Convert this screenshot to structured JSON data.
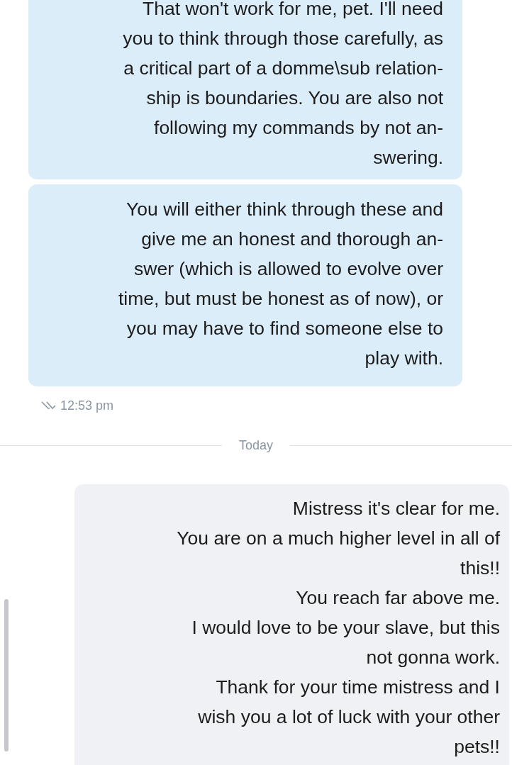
{
  "thread": [
    {
      "kind": "incoming",
      "text": "That won't work for me, pet. I'll need\nyou to think through those carefully, as\na critical part of a domme\\sub relation-\nship is boundaries. You are also not\nfollowing my commands by not an-\nswering."
    },
    {
      "kind": "incoming",
      "text": "You will either think through these and\ngive me an honest and thorough an-\nswer (which is allowed to evolve over\ntime, but must be honest as of now), or\nyou may have to find someone else to\nplay with."
    },
    {
      "kind": "meta",
      "time": "12:53 pm",
      "read": true
    },
    {
      "kind": "divider",
      "label": "Today"
    },
    {
      "kind": "outgoing",
      "text": "Mistress it's clear for me.\nYou are on a much higher level in all of\nthis!!\nYou reach far above me.\nI would love to be your slave, but this\nnot gonna work.\nThank for your time mistress and I\nwish you a lot of luck with your other\npets!!"
    }
  ]
}
